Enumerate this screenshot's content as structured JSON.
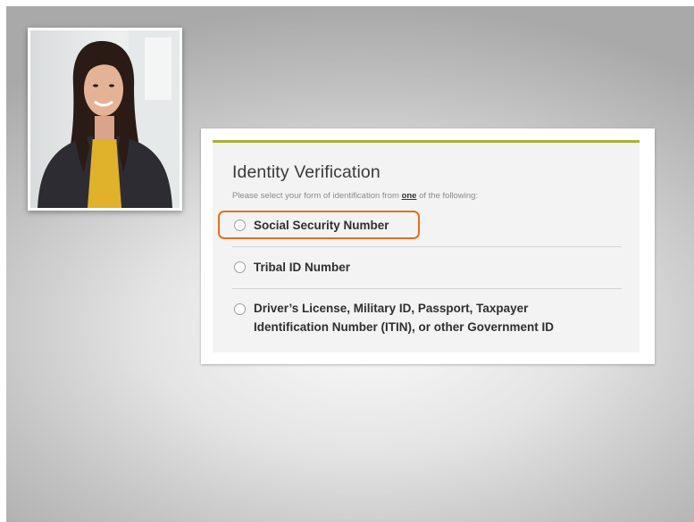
{
  "identity_form": {
    "title": "Identity Verification",
    "instruction_before": "Please select your form of identification from ",
    "instruction_emphasis": "one",
    "instruction_after": " of the following:",
    "options": [
      {
        "label": "Social Security Number",
        "highlighted": true
      },
      {
        "label": "Tribal ID Number",
        "highlighted": false
      },
      {
        "label": "Driver’s License, Military ID, Passport, Taxpayer",
        "label_line2": "Identification Number (ITIN), or other Government ID",
        "highlighted": false
      }
    ],
    "accent_color": "#a7b235",
    "highlight_color": "#e36f1e"
  }
}
